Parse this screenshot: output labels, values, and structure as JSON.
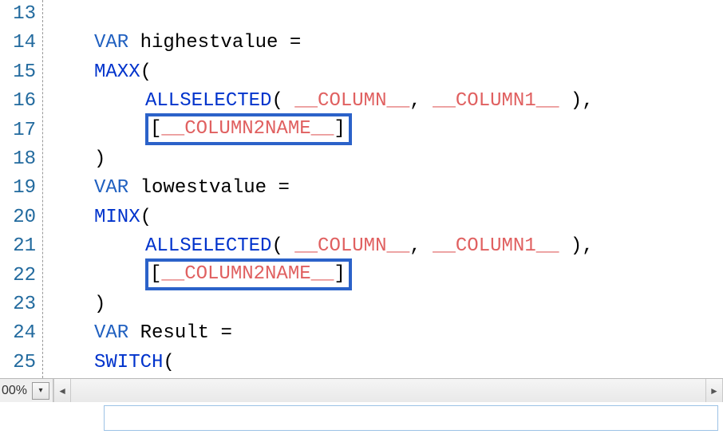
{
  "lines": [
    {
      "num": "13",
      "tokens": []
    },
    {
      "num": "14",
      "tokens": [
        {
          "cls": "indent i1"
        },
        {
          "cls": "kw",
          "t": "VAR "
        },
        {
          "cls": "id",
          "t": "highestvalue "
        },
        {
          "cls": "punct",
          "t": "="
        }
      ]
    },
    {
      "num": "15",
      "tokens": [
        {
          "cls": "indent i1"
        },
        {
          "cls": "fn",
          "t": "MAXX"
        },
        {
          "cls": "punct",
          "t": "("
        }
      ]
    },
    {
      "num": "16",
      "tokens": [
        {
          "cls": "indent i2"
        },
        {
          "cls": "fn",
          "t": "ALLSELECTED"
        },
        {
          "cls": "punct",
          "t": "( "
        },
        {
          "cls": "ph",
          "t": "__COLUMN__"
        },
        {
          "cls": "punct",
          "t": ", "
        },
        {
          "cls": "ph",
          "t": "__COLUMN1__"
        },
        {
          "cls": "punct",
          "t": " ),"
        }
      ]
    },
    {
      "num": "17",
      "tokens": [
        {
          "cls": "indent i2"
        },
        {
          "box": true,
          "inner": [
            {
              "cls": "punct",
              "t": "["
            },
            {
              "cls": "ph",
              "t": "__COLUMN2NAME__"
            },
            {
              "cls": "punct",
              "t": "]"
            }
          ]
        }
      ]
    },
    {
      "num": "18",
      "tokens": [
        {
          "cls": "indent i1"
        },
        {
          "cls": "punct",
          "t": ")"
        }
      ]
    },
    {
      "num": "19",
      "tokens": [
        {
          "cls": "indent i1"
        },
        {
          "cls": "kw",
          "t": "VAR "
        },
        {
          "cls": "id",
          "t": "lowestvalue "
        },
        {
          "cls": "punct",
          "t": "="
        }
      ]
    },
    {
      "num": "20",
      "tokens": [
        {
          "cls": "indent i1"
        },
        {
          "cls": "fn",
          "t": "MINX"
        },
        {
          "cls": "punct",
          "t": "("
        }
      ]
    },
    {
      "num": "21",
      "tokens": [
        {
          "cls": "indent i2"
        },
        {
          "cls": "fn",
          "t": "ALLSELECTED"
        },
        {
          "cls": "punct",
          "t": "( "
        },
        {
          "cls": "ph",
          "t": "__COLUMN__"
        },
        {
          "cls": "punct",
          "t": ", "
        },
        {
          "cls": "ph",
          "t": "__COLUMN1__"
        },
        {
          "cls": "punct",
          "t": " ),"
        }
      ]
    },
    {
      "num": "22",
      "tokens": [
        {
          "cls": "indent i2"
        },
        {
          "box": true,
          "inner": [
            {
              "cls": "punct",
              "t": "["
            },
            {
              "cls": "ph",
              "t": "__COLUMN2NAME__"
            },
            {
              "cls": "punct",
              "t": "]"
            }
          ]
        }
      ]
    },
    {
      "num": "23",
      "tokens": [
        {
          "cls": "indent i1"
        },
        {
          "cls": "punct",
          "t": ")"
        }
      ]
    },
    {
      "num": "24",
      "tokens": [
        {
          "cls": "indent i1"
        },
        {
          "cls": "kw",
          "t": "VAR "
        },
        {
          "cls": "id",
          "t": "Result "
        },
        {
          "cls": "punct",
          "t": "="
        }
      ]
    },
    {
      "num": "25",
      "tokens": [
        {
          "cls": "indent i1"
        },
        {
          "cls": "fn",
          "t": "SWITCH"
        },
        {
          "cls": "punct",
          "t": "("
        }
      ]
    }
  ],
  "zoom": {
    "value": "00%",
    "dropdown_glyph": "▾"
  },
  "hscroll": {
    "left_glyph": "◄",
    "right_glyph": "►"
  }
}
